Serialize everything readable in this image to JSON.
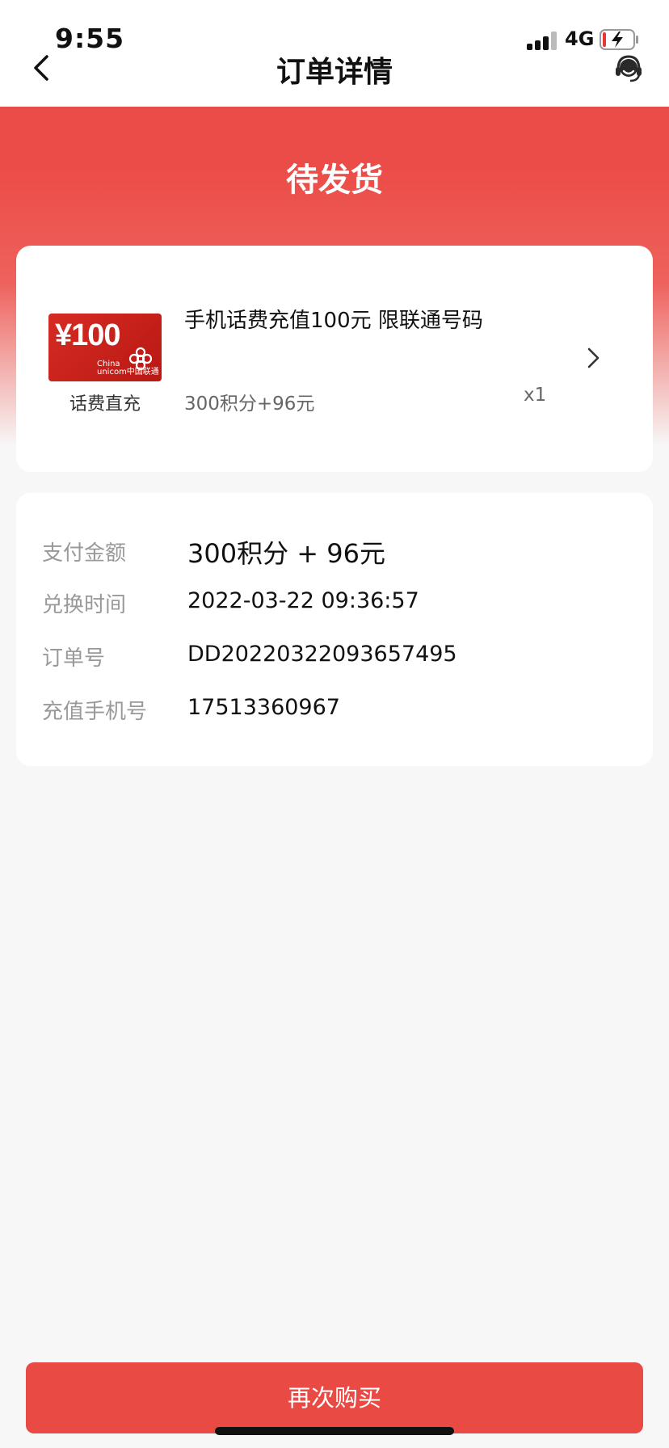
{
  "status_bar": {
    "time": "9:55",
    "network": "4G"
  },
  "nav": {
    "title": "订单详情"
  },
  "order_status": "待发货",
  "product": {
    "thumb_price": "¥100",
    "thumb_brand_line1": "China",
    "thumb_brand_line2": "unicom中国联通",
    "thumb_caption": "话费直充",
    "name": "手机话费充值100元 限联通号码",
    "price": "300积分+96元",
    "quantity": "x1"
  },
  "details": [
    {
      "label": "支付金额",
      "value": "300积分 + 96元"
    },
    {
      "label": "兑换时间",
      "value": "2022-03-22 09:36:57"
    },
    {
      "label": "订单号",
      "value": "DD20220322093657495"
    },
    {
      "label": "充值手机号",
      "value": "17513360967"
    }
  ],
  "buy_again_label": "再次购买",
  "colors": {
    "accent": "#e94a44",
    "background": "#f7f7f7",
    "label_gray": "#999999"
  }
}
